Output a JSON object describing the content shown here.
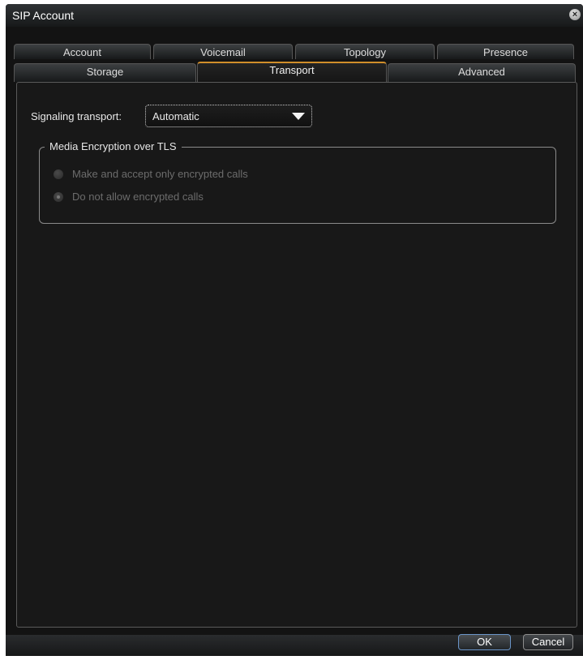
{
  "window": {
    "title": "SIP Account",
    "close_icon": "close-icon"
  },
  "tabs": {
    "row1": [
      {
        "label": "Account"
      },
      {
        "label": "Voicemail"
      },
      {
        "label": "Topology"
      },
      {
        "label": "Presence"
      }
    ],
    "row2": [
      {
        "label": "Storage"
      },
      {
        "label": "Transport",
        "active": true
      },
      {
        "label": "Advanced"
      }
    ]
  },
  "transport": {
    "signaling_label": "Signaling transport:",
    "signaling_value": "Automatic",
    "media_group": {
      "title": "Media Encryption over TLS",
      "options": [
        {
          "label": "Make and accept only encrypted calls",
          "checked": false,
          "disabled": true
        },
        {
          "label": "Do not allow encrypted calls",
          "checked": true,
          "disabled": true
        }
      ]
    }
  },
  "buttons": {
    "ok": "OK",
    "cancel": "Cancel"
  },
  "colors": {
    "window_bg": "#131313",
    "active_tab_accent": "#d08e2a",
    "ok_border": "#6a95c8"
  }
}
